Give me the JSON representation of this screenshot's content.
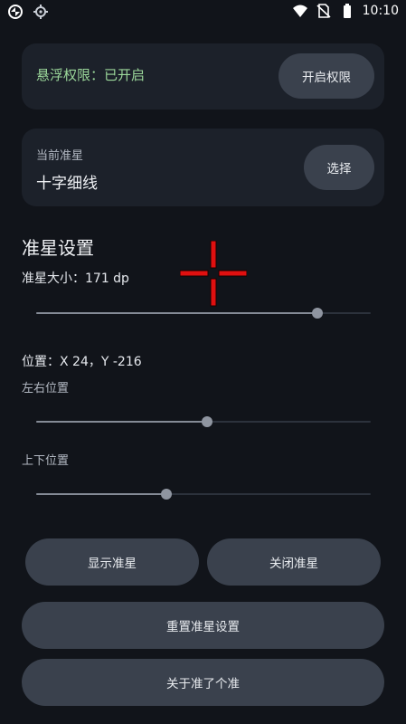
{
  "status_bar": {
    "time": "10:10",
    "left_icons": [
      "app-logo-icon",
      "settings-cog-icon"
    ],
    "right_icons": [
      "wifi-icon",
      "no-sim-icon",
      "battery-icon"
    ]
  },
  "permission": {
    "status_text": "悬浮权限：已开启",
    "enable_button": "开启权限"
  },
  "reticle": {
    "label": "当前准星",
    "value": "十字细线",
    "select_button": "选择"
  },
  "settings": {
    "title": "准星设置",
    "size_label": "准星大小：171 dp",
    "size_slider": 0.84,
    "position_label": "位置：X 24，Y -216",
    "horizontal_label": "左右位置",
    "horizontal_slider": 0.51,
    "vertical_label": "上下位置",
    "vertical_slider": 0.39
  },
  "buttons": {
    "show": "显示准星",
    "close": "关闭准星",
    "reset": "重置准星设置",
    "about": "关于准了个准"
  },
  "colors": {
    "background": "#11141a",
    "card": "#1c212a",
    "button": "#3a414d",
    "status_green": "#9bd79a",
    "crosshair_red": "#e01010"
  }
}
